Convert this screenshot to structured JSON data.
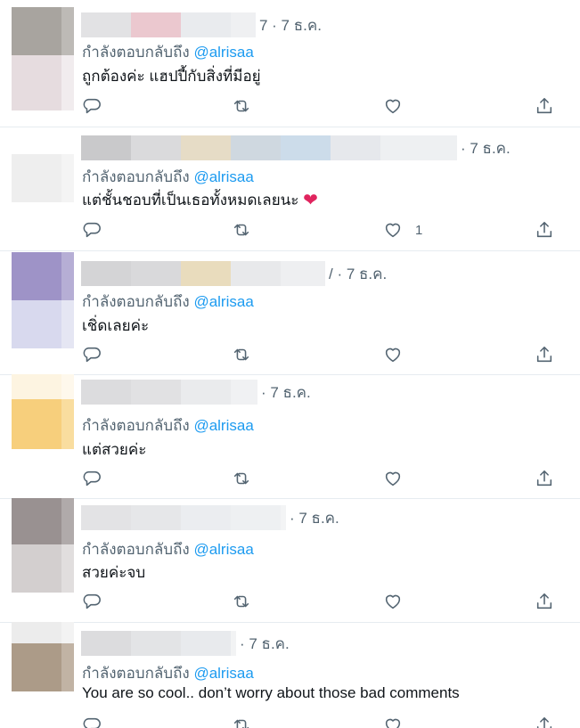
{
  "replies": [
    {
      "time": "7 · 7 ธ.ค.",
      "replying_prefix": "กำลังตอบกลับถึง",
      "mention": "@alrisaa",
      "text": "ถูกต้องค่ะ แฮปปี้กับสิ่งที่มีอยู่",
      "like_count": ""
    },
    {
      "time": "· 7 ธ.ค.",
      "replying_prefix": "กำลังตอบกลับถึง",
      "mention": "@alrisaa",
      "text": "แต่ชั้นชอบที่เป็นเธอทั้งหมดเลยนะ",
      "like_count": "1"
    },
    {
      "time": "/ · 7 ธ.ค.",
      "replying_prefix": "กำลังตอบกลับถึง",
      "mention": "@alrisaa",
      "text": "เชิ่ดเลยค่ะ",
      "like_count": ""
    },
    {
      "time": "· 7 ธ.ค.",
      "replying_prefix": "กำลังตอบกลับถึง",
      "mention": "@alrisaa",
      "text": "แต่สวยค่ะ",
      "like_count": ""
    },
    {
      "time": "· 7 ธ.ค.",
      "replying_prefix": "กำลังตอบกลับถึง",
      "mention": "@alrisaa",
      "text": "สวยค่ะจบ",
      "like_count": ""
    },
    {
      "time": "· 7 ธ.ค.",
      "replying_prefix": "กำลังตอบกลับถึง",
      "mention": "@alrisaa",
      "text": "You are so cool.. don’t worry about those bad comments",
      "like_count": ""
    }
  ],
  "icons": {
    "reply": "reply-icon",
    "retweet": "retweet-icon",
    "like": "like-icon",
    "share": "share-icon",
    "emoji": "red-heart-emoji"
  },
  "colors": {
    "accent": "#1d9bf0",
    "muted": "#536471",
    "text": "#0f1419",
    "heart": "#e0245e",
    "divider": "#e6ecf0"
  }
}
